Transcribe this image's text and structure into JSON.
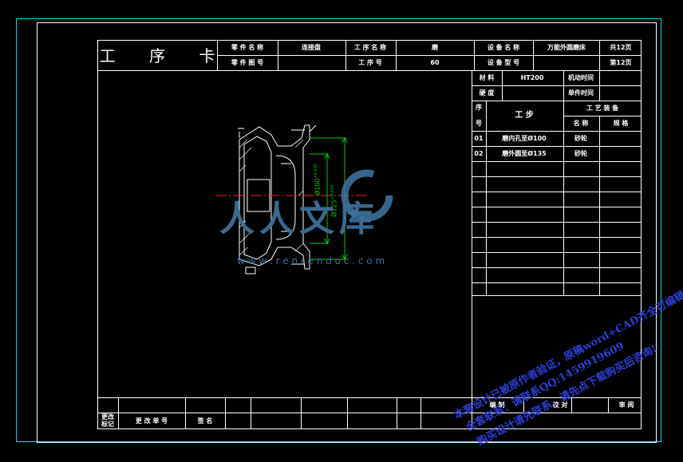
{
  "header": {
    "title": "工 序 卡",
    "part_name_label": "零 件 名 称",
    "part_name_value": "连接盘",
    "part_drawing_label": "零 件 图 号",
    "process_name_label": "工 序 名 称",
    "process_name_value": "磨",
    "process_no_label": "工 序 号",
    "process_no_value": "60",
    "equipment_name_label": "设 备 名 称",
    "equipment_name_value": "万能外圆磨床",
    "equipment_model_label": "设 备 型 号",
    "total_pages": "共12页",
    "page_no": "第12页"
  },
  "info": {
    "material_label": "材 料",
    "material_value": "HT200",
    "machine_time_label": "机动时间",
    "hardness_label": "硬 度",
    "piece_time_label": "单件时间",
    "seq_label_1": "序",
    "seq_label_2": "号",
    "step_label": "工 步",
    "equipment_label": "工 艺 装 备",
    "eq_name_label": "名 称",
    "eq_spec_label": "规 格"
  },
  "steps": [
    {
      "no": "01",
      "desc": "磨内孔至Ø100",
      "tool": "砂轮"
    },
    {
      "no": "02",
      "desc": "磨外圆至Ø135",
      "tool": "砂轮"
    }
  ],
  "drawing": {
    "dim_inner": "Ø100",
    "dim_inner_tol": "+0.035",
    "dim_outer": "Ø125",
    "dim_outer_tol": "+0.035"
  },
  "footer": {
    "marks_label_1": "更改",
    "marks_label_2": "标记",
    "change_doc_label": "更 改 单 号",
    "sign_label": "签 名",
    "compile_label": "编 制",
    "check_label": "校 对",
    "review_label": "审 阅"
  },
  "watermark": {
    "brand": "人人文库",
    "url": "w w w . r e n r e n d o c . c o m"
  },
  "notice": {
    "line1": "本套设计已被原作者验证，原稿word+CAD齐全可编辑!",
    "line2": "全套联系：请联系QQ:1459919609",
    "line3": "购买设计请先联系，请先点下载购买后咨询!"
  },
  "colors": {
    "frame": "#00e0e0",
    "lines": "#ffffff",
    "dimension": "#00d000",
    "centerline": "#ff2020",
    "watermark": "#3d6f9a",
    "notice": "#2f3fd6"
  }
}
